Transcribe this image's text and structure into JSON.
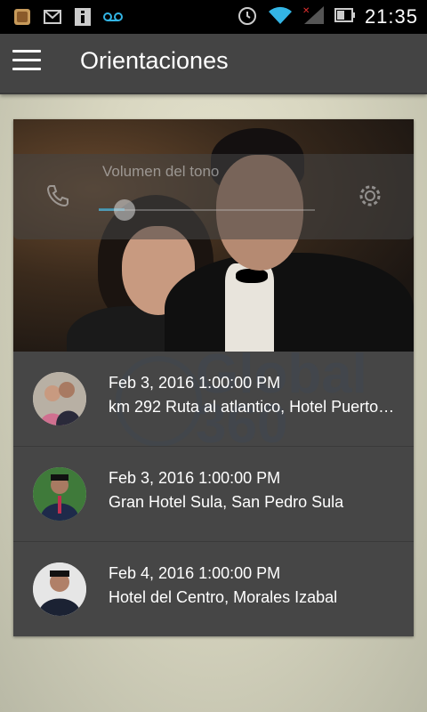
{
  "status_bar": {
    "time": "21:35",
    "icons": [
      "gallery-icon",
      "gmail-icon",
      "info-icon",
      "voicemail-icon",
      "alarm-icon",
      "wifi-icon",
      "signal-icon",
      "battery-icon"
    ]
  },
  "app_bar": {
    "title": "Orientaciones",
    "menu_icon": "hamburger-menu-icon"
  },
  "volume_overlay": {
    "label": "Volumen del tono",
    "level": 0.12
  },
  "events": [
    {
      "date": "Feb 3, 2016 1:00:00 PM",
      "location": "km 292 Ruta al atlantico, Hotel Puerto …"
    },
    {
      "date": "Feb 3, 2016 1:00:00 PM",
      "location": "Gran Hotel Sula, San Pedro Sula"
    },
    {
      "date": "Feb 4, 2016 1:00:00 PM",
      "location": "Hotel del Centro, Morales Izabal"
    }
  ],
  "watermark": {
    "line1": "Global",
    "line2": "360"
  },
  "colors": {
    "app_bar": "#444444",
    "card": "#464646",
    "accent": "#33b5e5"
  }
}
